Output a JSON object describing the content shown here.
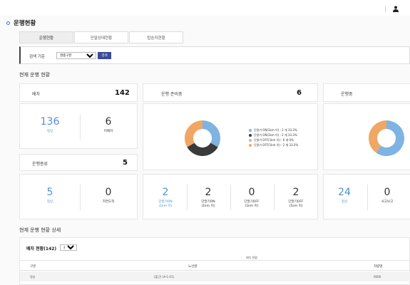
{
  "page": {
    "title": "운행현황"
  },
  "tabs": [
    {
      "label": "운행현황",
      "active": true
    },
    {
      "label": "단말상태현황",
      "active": false
    },
    {
      "label": "탑승자현황",
      "active": false
    }
  ],
  "search": {
    "label": "검색 기준",
    "select_value": "권종구분",
    "button_label": "검색"
  },
  "section_current": "현재 운행 현황",
  "dispatch": {
    "label": "배차",
    "total": "142",
    "stats": [
      {
        "value": "136",
        "label": "정상"
      },
      {
        "value": "6",
        "label": "미배차"
      }
    ]
  },
  "finished": {
    "label": "운행종료",
    "total": "5",
    "stats": [
      {
        "value": "5",
        "label": "정상"
      },
      {
        "value": "0",
        "label": "지연도착"
      }
    ]
  },
  "preparing": {
    "label": "운행 준비중",
    "total": "6",
    "legend": [
      {
        "text": "단말기 ON(1km 이) : 2 개 33.3%",
        "color": "#7fb3e3"
      },
      {
        "text": "단말기 ON(1km 이) : 2 개 33.3%",
        "color": "#3a3a3a"
      },
      {
        "text": "단말기 OFF(1km 이) : 0 개 0%",
        "color": "#b9b9b9"
      },
      {
        "text": "단말기 OFF(1km 이) : 2 개 33.3%",
        "color": "#f0a763"
      }
    ],
    "stats": [
      {
        "value": "2",
        "label": "단말기ON",
        "sub": "(1km 이)"
      },
      {
        "value": "2",
        "label": "단말기ON",
        "sub": "(1km 이)"
      },
      {
        "value": "0",
        "label": "단말기OFF",
        "sub": "(1km 이)"
      },
      {
        "value": "2",
        "label": "단말기OFF",
        "sub": "(1km 이)"
      }
    ]
  },
  "in_operation": {
    "label": "운행중",
    "stats": [
      {
        "value": "24",
        "label": "정상"
      },
      {
        "value": "0",
        "label": "사고보고"
      }
    ]
  },
  "donut_prep": [
    {
      "value": 2,
      "color": "#7fb3e3"
    },
    {
      "value": 2,
      "color": "#3a3a3a"
    },
    {
      "value": 0,
      "color": "#b9b9b9"
    },
    {
      "value": 2,
      "color": "#f0a763"
    }
  ],
  "donut_oper": [
    {
      "value": 0.6,
      "color": "#7fb3e3"
    },
    {
      "value": 0.4,
      "color": "#f0a763"
    }
  ],
  "section_detail": "현재 운행 현황 상세",
  "detail": {
    "heading": "배차 현황(142)",
    "filter_value": "전체",
    "caption": "배차 현황",
    "headers": [
      "구분",
      "노선명",
      "차량명"
    ],
    "row": [
      "정상",
      "(출근) (A-1-01)",
      "0000"
    ]
  }
}
